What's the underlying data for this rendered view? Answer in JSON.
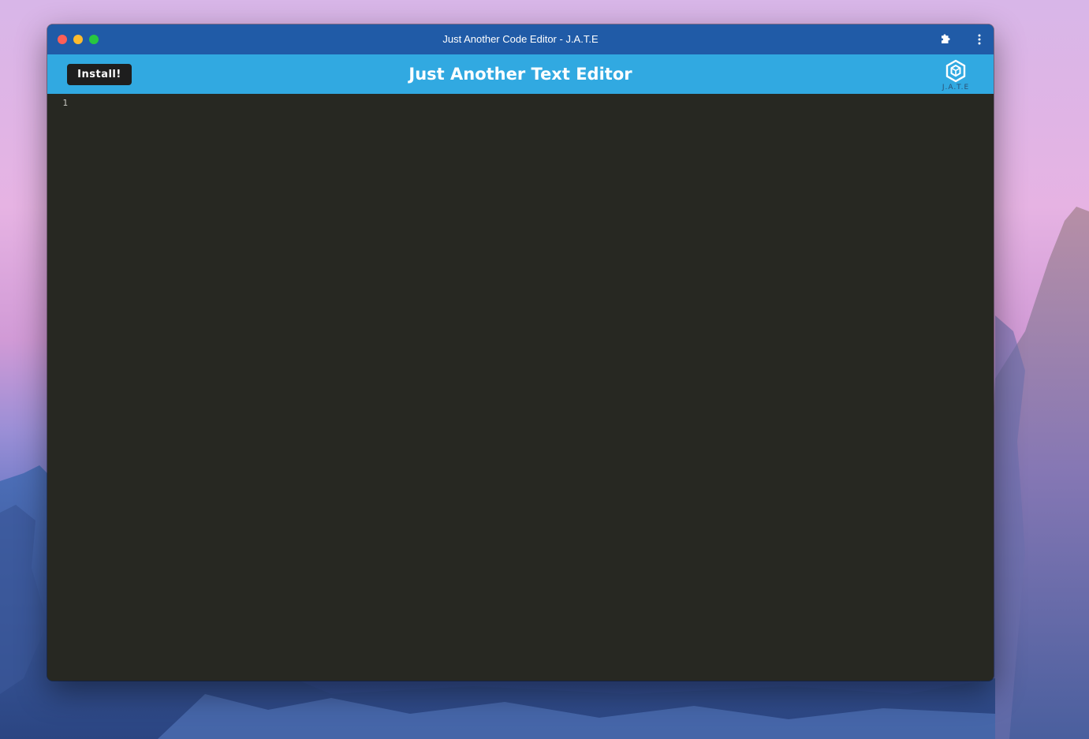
{
  "window": {
    "title": "Just Another Code Editor - J.A.T.E"
  },
  "header": {
    "install_label": "Install!",
    "title": "Just Another Text Editor",
    "logo_text": "J.A.T.E"
  },
  "editor": {
    "line_numbers": [
      "1"
    ],
    "content": ""
  },
  "icons": {
    "traffic_close": "close-circle-icon",
    "traffic_minimize": "minimize-circle-icon",
    "traffic_maximize": "maximize-circle-icon",
    "extensions": "puzzle-piece-icon",
    "menu": "kebab-menu-icon",
    "logo": "hexagon-cube-logo-icon"
  },
  "colors": {
    "titlebar": "#205ba7",
    "header": "#31a9e1",
    "install_button": "#1e1e1e",
    "editor_background": "#272822",
    "line_number": "#c8c8c2",
    "logo_text": "#2a4f73"
  }
}
